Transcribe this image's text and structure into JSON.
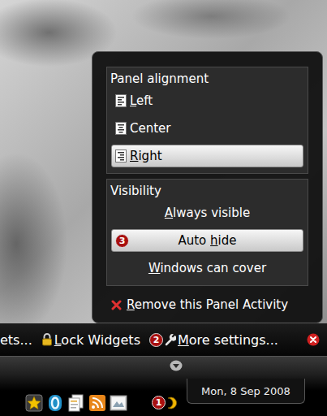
{
  "menu": {
    "sections": [
      {
        "title": "Panel alignment",
        "items": [
          {
            "label": "Left",
            "kind": "left",
            "selected": false,
            "mnemonic": 0
          },
          {
            "label": "Center",
            "kind": "center",
            "selected": false,
            "mnemonic": -1
          },
          {
            "label": "Right",
            "kind": "right",
            "selected": true,
            "mnemonic": 0
          }
        ]
      },
      {
        "title": "Visibility",
        "items": [
          {
            "label": "Always visible",
            "kind": "plain",
            "selected": false,
            "mnemonic": 0
          },
          {
            "label": "Auto hide",
            "kind": "plain",
            "selected": true,
            "mnemonic": 5,
            "badge": "3"
          },
          {
            "label": "Windows can cover",
            "kind": "plain",
            "selected": false,
            "mnemonic": 0
          }
        ]
      }
    ],
    "remove": {
      "label": "Remove this Panel Activity",
      "mnemonic": 0
    }
  },
  "toolbar": {
    "items": [
      {
        "label": "ets...",
        "kind": "text",
        "mnemonic": -1
      },
      {
        "label": "Lock Widgets",
        "kind": "lock",
        "mnemonic": 0
      },
      {
        "label": "More settings...",
        "kind": "settings",
        "mnemonic": 0,
        "badge": "2"
      }
    ]
  },
  "panel": {
    "notifier": {
      "badge": "1"
    },
    "clock": "Mon, 8 Sep 2008"
  }
}
